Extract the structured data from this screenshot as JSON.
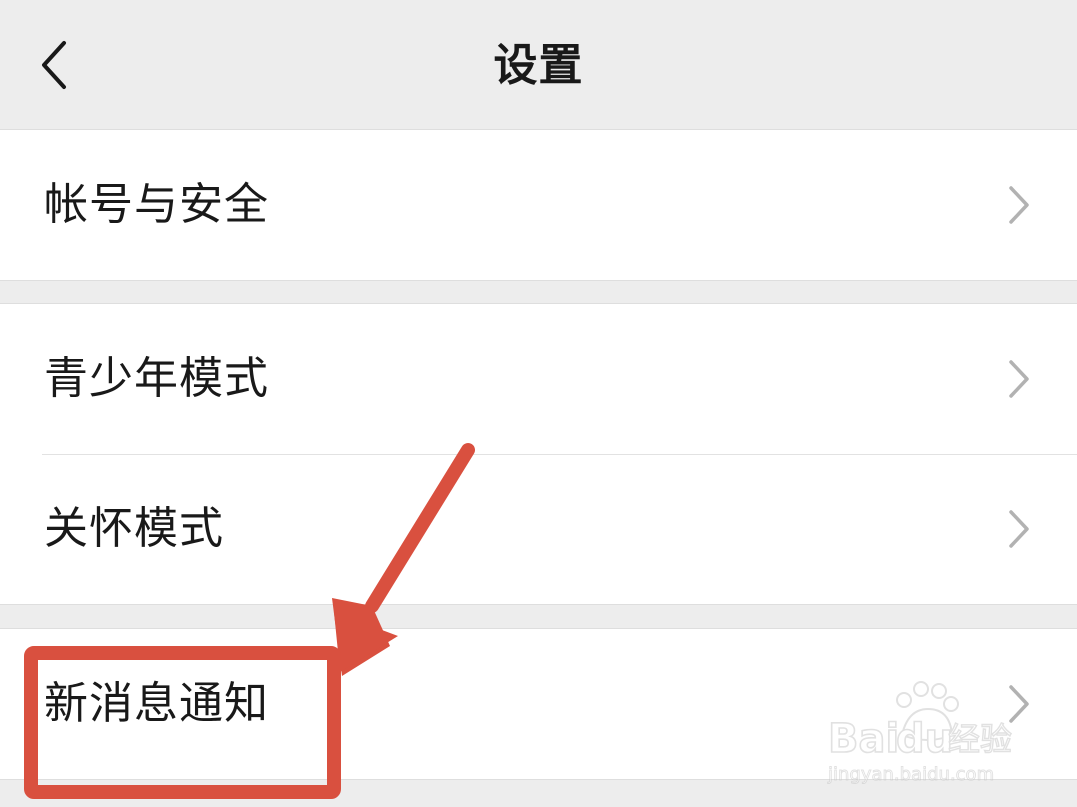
{
  "header": {
    "title": "设置",
    "back_icon": "chevron-left-icon"
  },
  "settings": {
    "groups": [
      {
        "items": [
          {
            "label": "帐号与安全",
            "icon": "chevron-right-icon"
          }
        ]
      },
      {
        "items": [
          {
            "label": "青少年模式",
            "icon": "chevron-right-icon"
          },
          {
            "label": "关怀模式",
            "icon": "chevron-right-icon"
          }
        ]
      },
      {
        "items": [
          {
            "label": "新消息通知",
            "icon": "chevron-right-icon"
          }
        ]
      }
    ]
  },
  "annotation": {
    "color": "#d9503f",
    "shape": "arrow-and-box",
    "target": "新消息通知"
  },
  "watermark": {
    "brand": "Bai du 经验",
    "url": "jingyan.baidu.com"
  },
  "colors": {
    "background": "#ededed",
    "card": "#ffffff",
    "text": "#191919",
    "chevron": "#b2b2b2"
  }
}
